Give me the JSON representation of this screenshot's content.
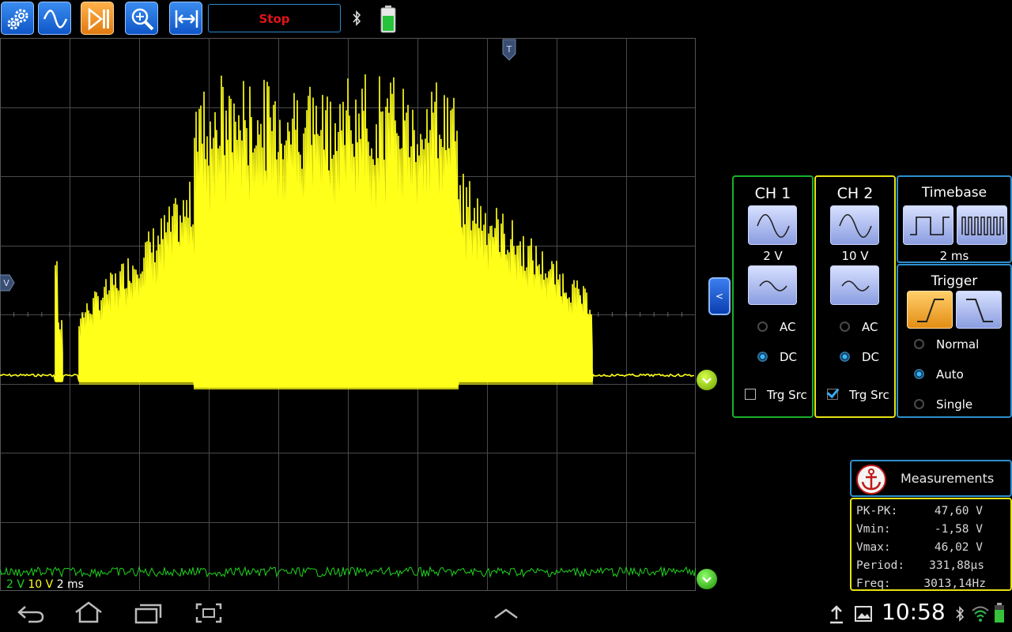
{
  "toolbar": {
    "stop_label": "Stop"
  },
  "panels": {
    "ch1": {
      "title": "CH 1",
      "volts": "2 V",
      "ac_label": "AC",
      "dc_label": "DC",
      "trg_label": "Trg Src",
      "coupling": "DC",
      "trg_checked": false,
      "color": "#18b02a"
    },
    "ch2": {
      "title": "CH 2",
      "volts": "10 V",
      "ac_label": "AC",
      "dc_label": "DC",
      "trg_label": "Trg Src",
      "coupling": "DC",
      "trg_checked": true,
      "color": "#e6e212"
    },
    "timebase": {
      "title": "Timebase",
      "value": "2 ms",
      "color": "#2e8fce"
    },
    "trigger": {
      "title": "Trigger",
      "modes": [
        "Normal",
        "Auto",
        "Single"
      ],
      "selected": "Auto",
      "color": "#2e8fce"
    }
  },
  "scope": {
    "status": {
      "ch1": "2 V",
      "ch2": "10 V",
      "time": "2 ms"
    },
    "trigger_marker": "T",
    "level_marker": "V",
    "colors": {
      "ch1": "#1ed51e",
      "ch2": "#ffff1a",
      "grid": "#4a4a4a"
    }
  },
  "collapse_label": "<",
  "measurements": {
    "title": "Measurements",
    "rows": [
      {
        "label": "PK-PK:",
        "value": "47,60 V"
      },
      {
        "label": "Vmin:",
        "value": "-1,58 V"
      },
      {
        "label": "Vmax:",
        "value": "46,02 V"
      },
      {
        "label": "Period:",
        "value": "331,88µs"
      },
      {
        "label": "Freq:",
        "value": "3013,14Hz"
      }
    ]
  },
  "system_bar": {
    "clock": "10:58"
  }
}
